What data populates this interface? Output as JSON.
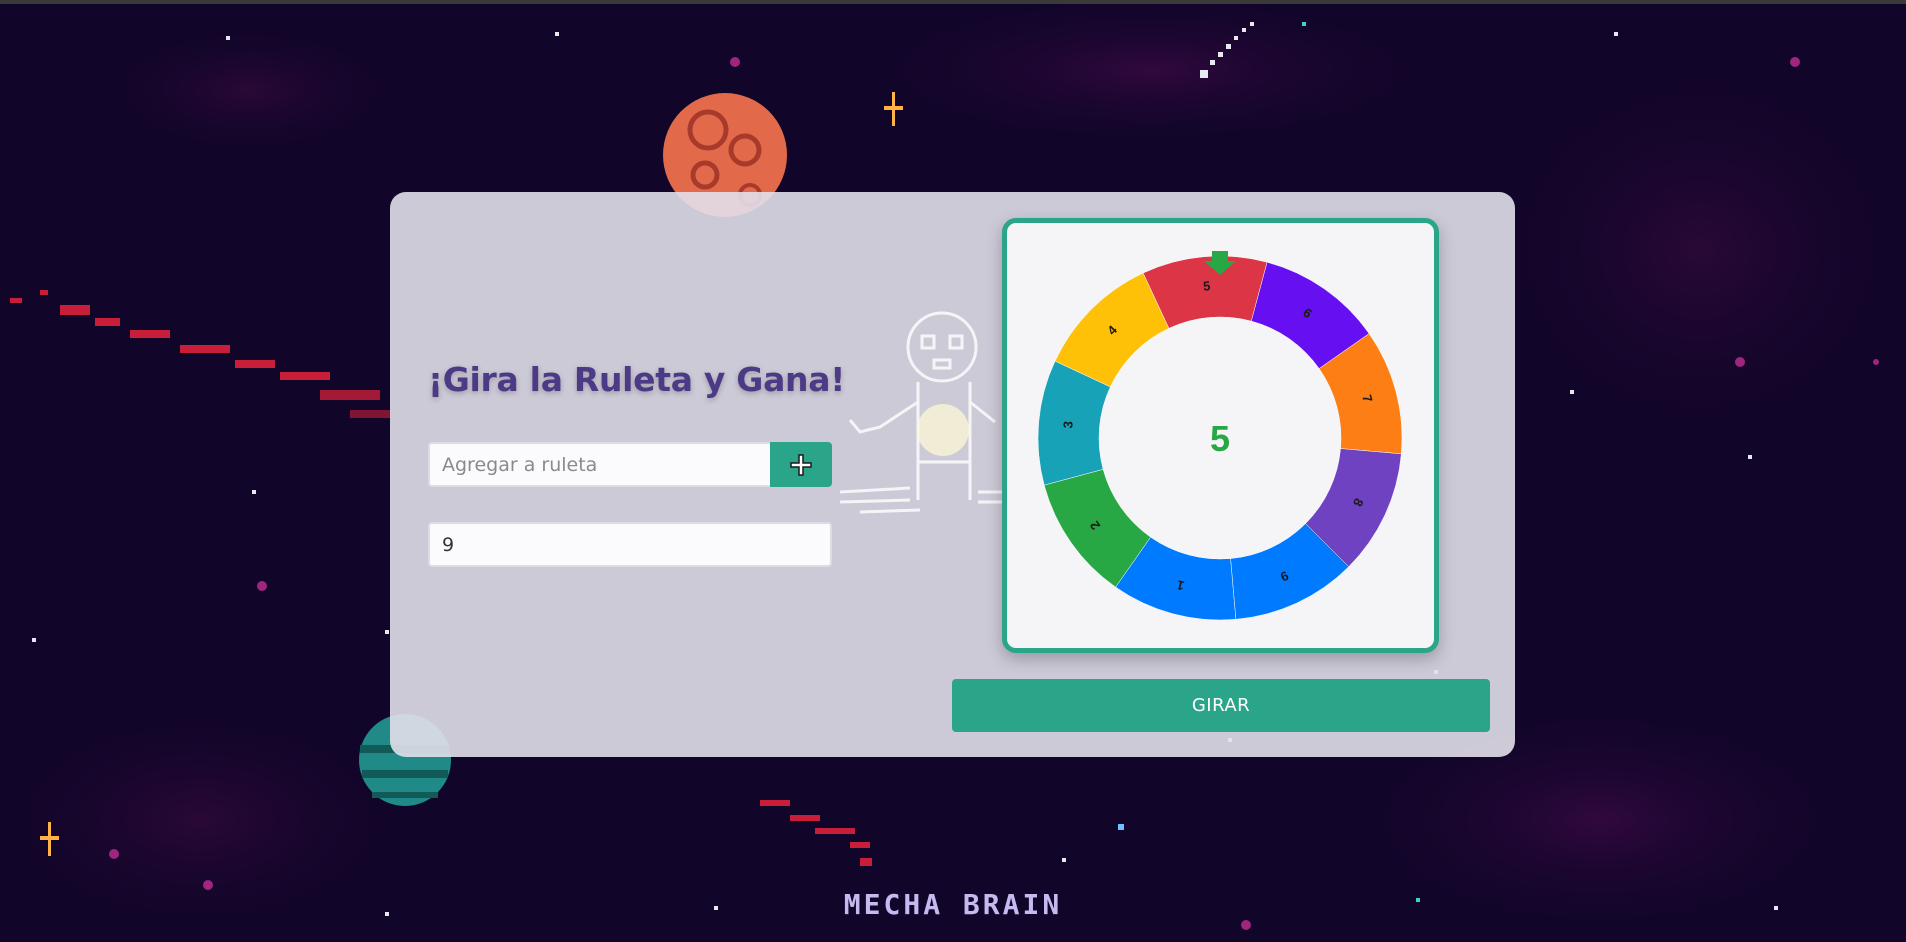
{
  "title": "¡Gira la Ruleta y Gana!",
  "add_input": {
    "placeholder": "Agregar a ruleta",
    "value": ""
  },
  "add_button_icon": "plus-icon",
  "count_input": {
    "value": "9"
  },
  "wheel": {
    "center_value": "5",
    "pointer_icon": "arrow-down-icon",
    "segments": [
      {
        "label": "5",
        "color": "#dc3545"
      },
      {
        "label": "6",
        "color": "#6610f2"
      },
      {
        "label": "7",
        "color": "#fd7e14"
      },
      {
        "label": "8",
        "color": "#6f42c1"
      },
      {
        "label": "9",
        "color": "#007bff"
      },
      {
        "label": "1",
        "color": "#007bff"
      },
      {
        "label": "2",
        "color": "#28a745"
      },
      {
        "label": "3",
        "color": "#17a2b8"
      },
      {
        "label": "4",
        "color": "#ffc107"
      }
    ]
  },
  "spin_button": "GIRAR",
  "brand": "MECHA BRAIN",
  "colors": {
    "accent": "#2aa58a",
    "title": "#4c3a87",
    "background": "#12052a"
  }
}
